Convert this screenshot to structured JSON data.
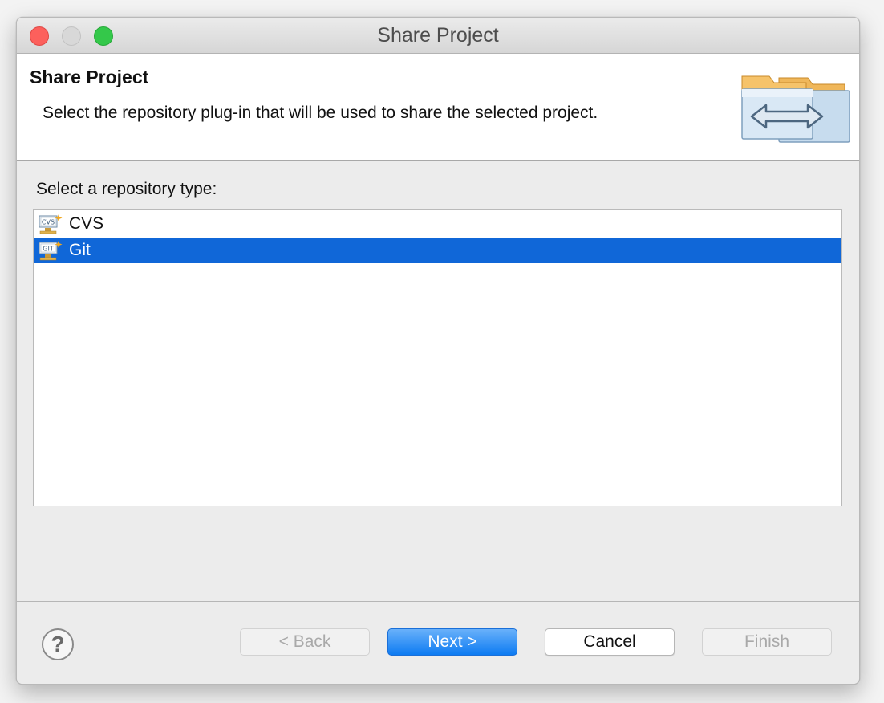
{
  "window": {
    "title": "Share Project"
  },
  "banner": {
    "title": "Share Project",
    "description": "Select the repository plug-in that will be used to share the selected project.",
    "icon": "share-folders-icon"
  },
  "repository_list": {
    "label": "Select a repository type:",
    "items": [
      {
        "label": "CVS",
        "icon": "cvs-repository-icon",
        "selected": false
      },
      {
        "label": "Git",
        "icon": "git-repository-icon",
        "selected": true
      }
    ]
  },
  "footer": {
    "help_icon": "help-icon",
    "back_label": "< Back",
    "next_label": "Next >",
    "cancel_label": "Cancel",
    "finish_label": "Finish"
  },
  "colors": {
    "selection": "#1067d8",
    "default_button": "#0d7bf2",
    "close": "#fc605c",
    "maximize": "#34c84a"
  }
}
